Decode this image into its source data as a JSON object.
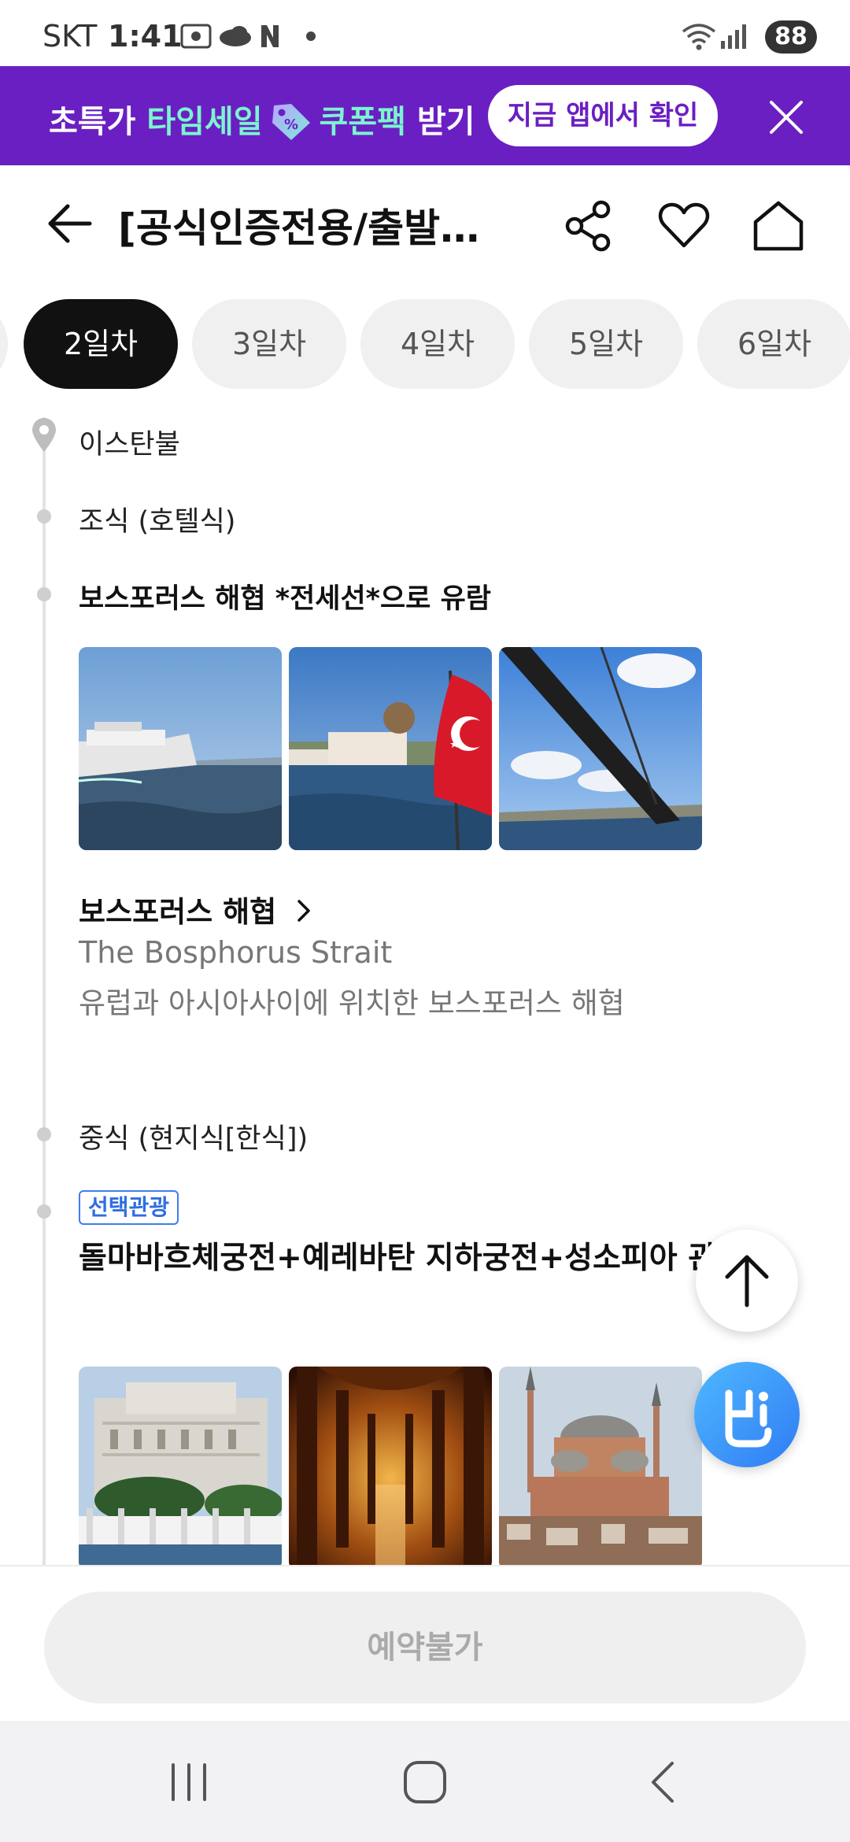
{
  "status_bar": {
    "carrier": "SKT",
    "time": "1:41",
    "battery": "88",
    "icons": [
      "screenshot-icon",
      "cloud-icon",
      "naver-icon",
      "dot-icon",
      "wifi-icon",
      "signal-icon"
    ]
  },
  "promo": {
    "text_pre": "초특가 ",
    "text_highlight1": "타임세일",
    "text_highlight2": "쿠폰팩",
    "text_post": " 받기",
    "button": "지금 앱에서 확인",
    "accent": "#6a1fc2",
    "highlight_color": "#7cf4cf"
  },
  "header": {
    "title": "[공식인증전용/출발확…",
    "icons": [
      "back-arrow-icon",
      "share-icon",
      "heart-icon",
      "home-icon"
    ]
  },
  "tabs": [
    {
      "label": "2일차",
      "active": true
    },
    {
      "label": "3일차",
      "active": false
    },
    {
      "label": "4일차",
      "active": false
    },
    {
      "label": "5일차",
      "active": false
    },
    {
      "label": "6일차",
      "active": false
    }
  ],
  "timeline": {
    "location": "이스탄불",
    "items": [
      {
        "text": "조식 (호텔식)"
      },
      {
        "text": "보스포러스 해협 *전세선*으로 유람"
      },
      {
        "text": "중식 (현지식[한식])"
      }
    ],
    "place": {
      "name": "보스포러스 해협",
      "english": "The Bosphorus Strait",
      "description": "유럽과 아시아사이에 위치한 보스포러스 해협"
    },
    "optional_tour": {
      "badge": "선택관광",
      "title": "돌마바흐체궁전+예레바탄 지하궁전+성소피아 관광"
    }
  },
  "bottom": {
    "button": "예약불가"
  },
  "colors": {
    "tab_active_bg": "#111111",
    "badge": "#2f6ee0"
  }
}
